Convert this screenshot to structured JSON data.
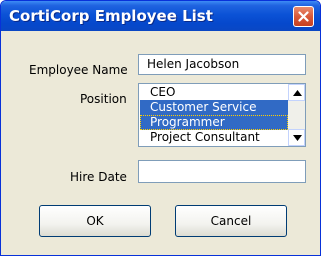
{
  "window": {
    "title": "CortiCorp Employee List",
    "close_icon": "close-icon"
  },
  "form": {
    "employee_name_label": "Employee Name",
    "employee_name_value": "Helen Jacobson",
    "position_label": "Position",
    "position_options": [
      {
        "label": "CEO",
        "selected": false
      },
      {
        "label": "Customer Service",
        "selected": true
      },
      {
        "label": "Programmer",
        "selected": true
      },
      {
        "label": "Project Consultant",
        "selected": false
      }
    ],
    "hire_date_label": "Hire Date",
    "hire_date_value": ""
  },
  "buttons": {
    "ok_label": "OK",
    "cancel_label": "Cancel"
  },
  "colors": {
    "titlebar": "#0548cc",
    "selection": "#316ac5",
    "dialog_bg": "#ece9d8"
  }
}
